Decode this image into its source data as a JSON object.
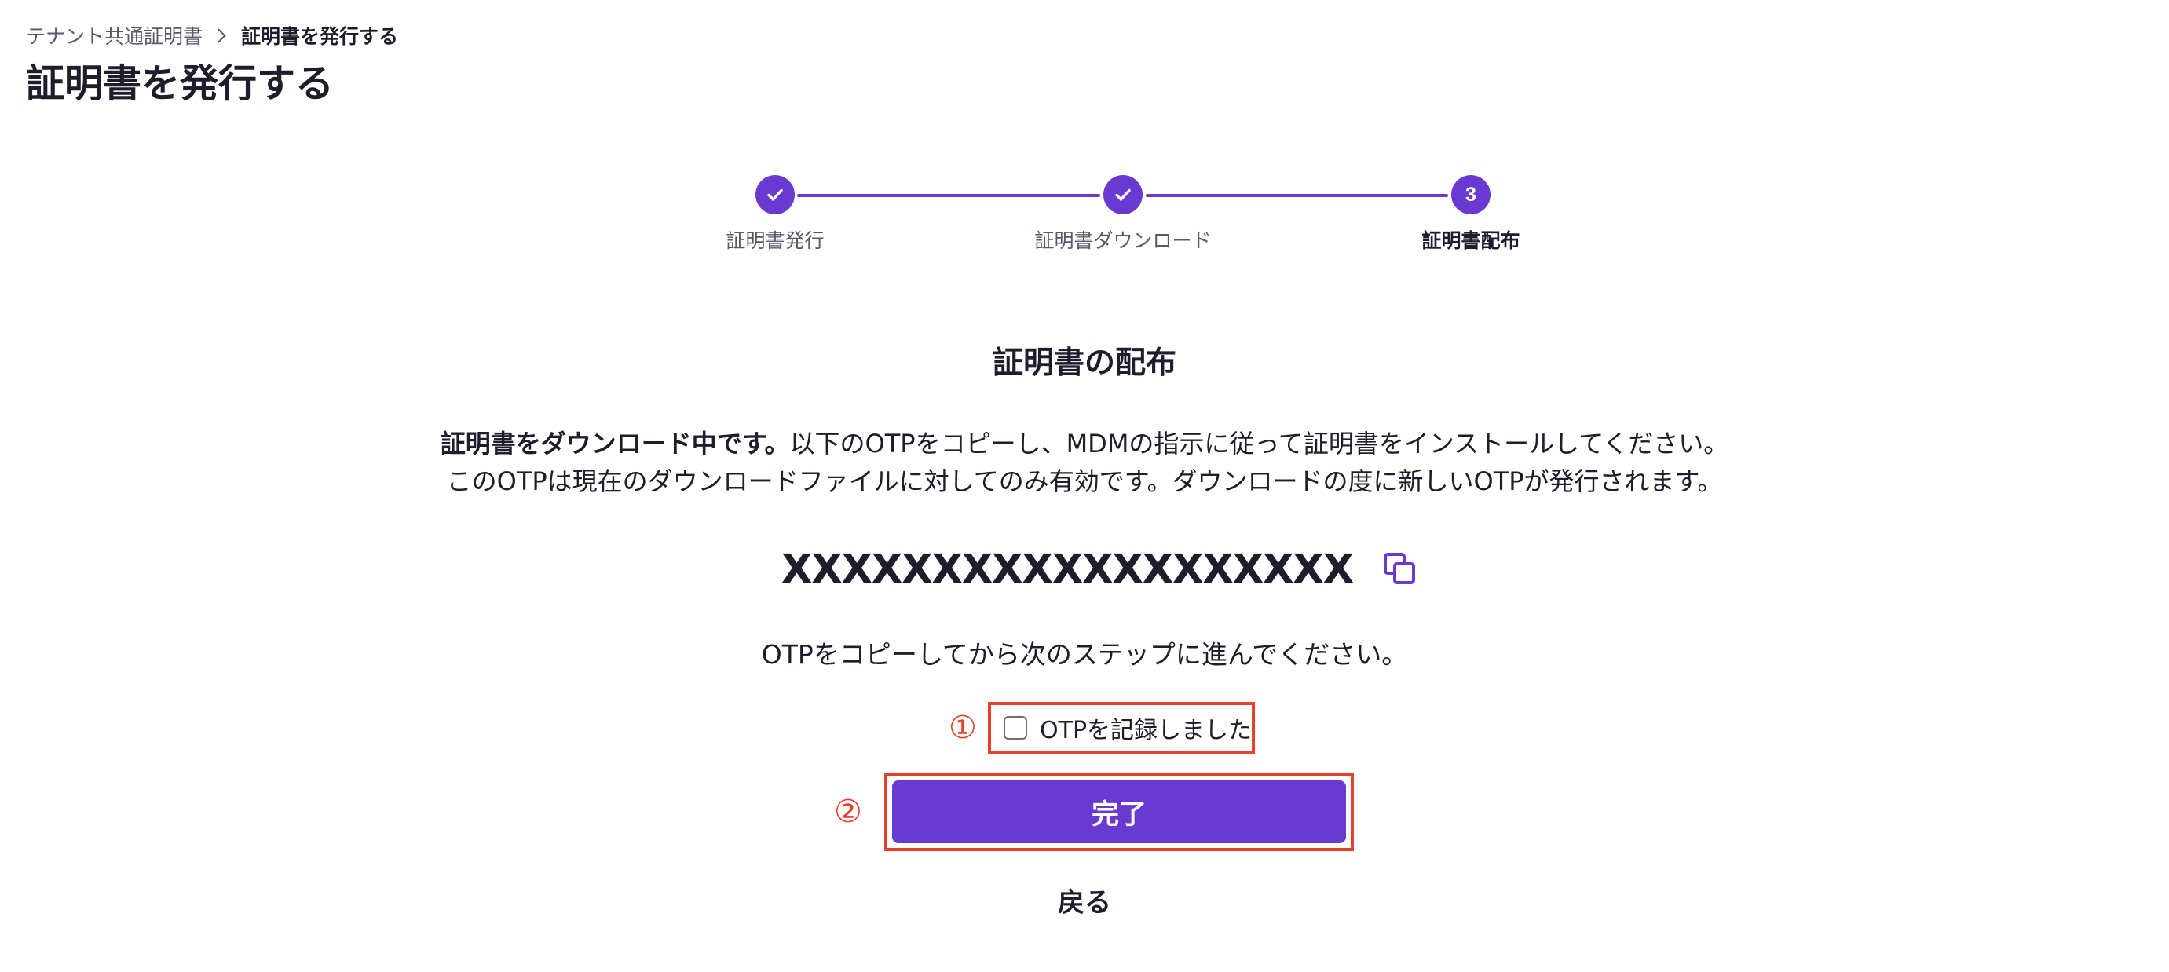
{
  "breadcrumb": {
    "parent": "テナント共通証明書",
    "current": "証明書を発行する"
  },
  "page_title": "証明書を発行する",
  "stepper": {
    "steps": [
      {
        "label": "証明書発行",
        "status": "completed",
        "icon": "check-icon"
      },
      {
        "label": "証明書ダウンロード",
        "status": "completed",
        "icon": "check-icon"
      },
      {
        "label": "証明書配布",
        "status": "active",
        "number": "3"
      }
    ]
  },
  "main": {
    "section_title": "証明書の配布",
    "desc_bold": "証明書をダウンロード中です。",
    "desc_line1_rest": "以下のOTPをコピーし、MDMの指示に従って証明書をインストールしてください。",
    "desc_line2": "このOTPは現在のダウンロードファイルに対してのみ有効です。ダウンロードの度に新しいOTPが発行されます。",
    "otp_value": "XXXXXXXXXXXXXXXXXXX",
    "copy_icon": "copy-icon",
    "instruction": "OTPをコピーしてから次のステップに進んでください。",
    "checkbox_label": "OTPを記録しました",
    "checkbox_checked": false,
    "done_button": "完了",
    "back_link": "戻る"
  },
  "annotations": {
    "marker_1": "①",
    "marker_2": "②",
    "color": "#e8412b"
  },
  "colors": {
    "accent": "#6a39d1",
    "text": "#1f1d2b",
    "muted": "#5a5768"
  }
}
